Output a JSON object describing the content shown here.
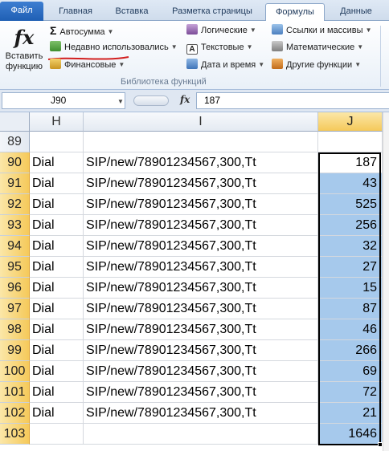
{
  "tabs": [
    {
      "label": "Файл"
    },
    {
      "label": "Главная"
    },
    {
      "label": "Вставка"
    },
    {
      "label": "Разметка страницы"
    },
    {
      "label": "Формулы"
    },
    {
      "label": "Данные"
    }
  ],
  "ribbon": {
    "insert_function_line1": "Вставить",
    "insert_function_line2": "функцию",
    "insert_function_glyph": "fx",
    "group_caption": "Библиотека функций",
    "commands": [
      {
        "label": "Автосумма",
        "icon": "sigma-icon"
      },
      {
        "label": "Недавно использовались",
        "icon": "recent-functions-icon"
      },
      {
        "label": "Финансовые",
        "icon": "financial-icon"
      },
      {
        "label": "Логические",
        "icon": "logical-icon"
      },
      {
        "label": "Текстовые",
        "icon": "text-functions-icon"
      },
      {
        "label": "Дата и время",
        "icon": "date-time-icon"
      },
      {
        "label": "Ссылки и массивы",
        "icon": "lookup-reference-icon"
      },
      {
        "label": "Математические",
        "icon": "math-trig-icon"
      },
      {
        "label": "Другие функции",
        "icon": "more-functions-icon"
      }
    ]
  },
  "formula_bar": {
    "name_box": "J90",
    "fx_glyph": "fx",
    "value": "187"
  },
  "sheet": {
    "columns": [
      "H",
      "I",
      "J"
    ],
    "rows": [
      {
        "row": "89",
        "h": "",
        "i": "",
        "j": ""
      },
      {
        "row": "90",
        "h": "Dial",
        "i": "SIP/new/78901234567,300,Tt",
        "j": "187"
      },
      {
        "row": "91",
        "h": "Dial",
        "i": "SIP/new/78901234567,300,Tt",
        "j": "43"
      },
      {
        "row": "92",
        "h": "Dial",
        "i": "SIP/new/78901234567,300,Tt",
        "j": "525"
      },
      {
        "row": "93",
        "h": "Dial",
        "i": "SIP/new/78901234567,300,Tt",
        "j": "256"
      },
      {
        "row": "94",
        "h": "Dial",
        "i": "SIP/new/78901234567,300,Tt",
        "j": "32"
      },
      {
        "row": "95",
        "h": "Dial",
        "i": "SIP/new/78901234567,300,Tt",
        "j": "27"
      },
      {
        "row": "96",
        "h": "Dial",
        "i": "SIP/new/78901234567,300,Tt",
        "j": "15"
      },
      {
        "row": "97",
        "h": "Dial",
        "i": "SIP/new/78901234567,300,Tt",
        "j": "87"
      },
      {
        "row": "98",
        "h": "Dial",
        "i": "SIP/new/78901234567,300,Tt",
        "j": "46"
      },
      {
        "row": "99",
        "h": "Dial",
        "i": "SIP/new/78901234567,300,Tt",
        "j": "266"
      },
      {
        "row": "100",
        "h": "Dial",
        "i": "SIP/new/78901234567,300,Tt",
        "j": "69"
      },
      {
        "row": "101",
        "h": "Dial",
        "i": "SIP/new/78901234567,300,Tt",
        "j": "72"
      },
      {
        "row": "102",
        "h": "Dial",
        "i": "SIP/new/78901234567,300,Tt",
        "j": "21"
      },
      {
        "row": "103",
        "h": "",
        "i": "",
        "j": "1646"
      }
    ]
  },
  "colors": {
    "selection_fill": "#a6c9ec",
    "header_highlight": "#f5c95a",
    "annotation_underline": "#d21f1f"
  }
}
